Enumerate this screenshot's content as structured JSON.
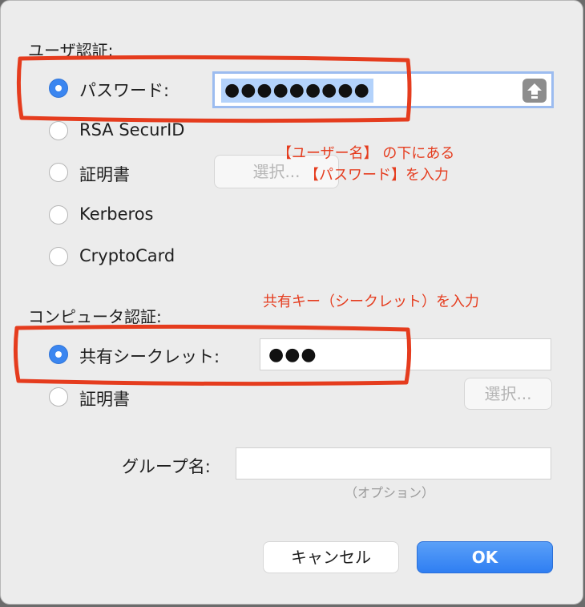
{
  "user_auth": {
    "heading": "ユーザ認証:",
    "options": [
      {
        "label": "パスワード:",
        "checked": true
      },
      {
        "label": "RSA SecurID",
        "checked": false
      },
      {
        "label": "証明書",
        "checked": false
      },
      {
        "label": "Kerberos",
        "checked": false
      },
      {
        "label": "CryptoCard",
        "checked": false
      }
    ],
    "password_value": "●●●●●●●●●",
    "select_button": "選択..."
  },
  "computer_auth": {
    "heading": "コンピュータ認証:",
    "options": [
      {
        "label": "共有シークレット:",
        "checked": true
      },
      {
        "label": "証明書",
        "checked": false
      }
    ],
    "secret_value": "●●●",
    "select_button": "選択..."
  },
  "group": {
    "label": "グループ名:",
    "value": "",
    "hint": "（オプション）"
  },
  "buttons": {
    "cancel": "キャンセル",
    "ok": "OK"
  },
  "annotations": {
    "note1_line1": "【ユーザー名】 の下にある",
    "note1_line2": "【パスワード】を入力",
    "note2": "共有キー（シークレット）を入力",
    "highlight_color": "#e53c1e"
  }
}
